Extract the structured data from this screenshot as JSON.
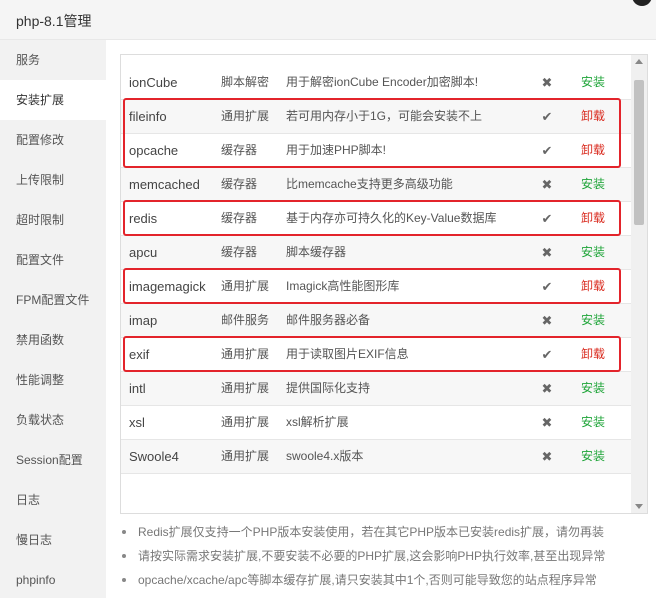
{
  "window": {
    "title": "php-8.1管理"
  },
  "sidebar": {
    "items": [
      {
        "label": "服务"
      },
      {
        "label": "安装扩展"
      },
      {
        "label": "配置修改"
      },
      {
        "label": "上传限制"
      },
      {
        "label": "超时限制"
      },
      {
        "label": "配置文件"
      },
      {
        "label": "FPM配置文件"
      },
      {
        "label": "禁用函数"
      },
      {
        "label": "性能调整"
      },
      {
        "label": "负载状态"
      },
      {
        "label": "Session配置"
      },
      {
        "label": "日志"
      },
      {
        "label": "慢日志"
      },
      {
        "label": "phpinfo"
      }
    ],
    "active_index": 1
  },
  "extensions": [
    {
      "name": "ionCube",
      "type": "脚本解密",
      "desc": "用于解密ionCube Encoder加密脚本!",
      "status": "x",
      "action": "安装"
    },
    {
      "name": "fileinfo",
      "type": "通用扩展",
      "desc": "若可用内存小于1G，可能会安装不上",
      "status": "check",
      "action": "卸载"
    },
    {
      "name": "opcache",
      "type": "缓存器",
      "desc": "用于加速PHP脚本!",
      "status": "check",
      "action": "卸载"
    },
    {
      "name": "memcached",
      "type": "缓存器",
      "desc": "比memcache支持更多高级功能",
      "status": "x",
      "action": "安装"
    },
    {
      "name": "redis",
      "type": "缓存器",
      "desc": "基于内存亦可持久化的Key-Value数据库",
      "status": "check",
      "action": "卸载"
    },
    {
      "name": "apcu",
      "type": "缓存器",
      "desc": "脚本缓存器",
      "status": "x",
      "action": "安装"
    },
    {
      "name": "imagemagick",
      "type": "通用扩展",
      "desc": "Imagick高性能图形库",
      "status": "check",
      "action": "卸载"
    },
    {
      "name": "imap",
      "type": "邮件服务",
      "desc": "邮件服务器必备",
      "status": "x",
      "action": "安装"
    },
    {
      "name": "exif",
      "type": "通用扩展",
      "desc": "用于读取图片EXIF信息",
      "status": "check",
      "action": "卸载"
    },
    {
      "name": "intl",
      "type": "通用扩展",
      "desc": "提供国际化支持",
      "status": "x",
      "action": "安装"
    },
    {
      "name": "xsl",
      "type": "通用扩展",
      "desc": "xsl解析扩展",
      "status": "x",
      "action": "安装"
    },
    {
      "name": "Swoole4",
      "type": "通用扩展",
      "desc": "swoole4.x版本",
      "status": "x",
      "action": "安装"
    }
  ],
  "notes": [
    "Redis扩展仅支持一个PHP版本安装使用，若在其它PHP版本已安装redis扩展，请勿再装",
    "请按实际需求安装扩展,不要安装不必要的PHP扩展,这会影响PHP执行效率,甚至出现异常",
    "opcache/xcache/apc等脚本缓存扩展,请只安装其中1个,否则可能导致您的站点程序异常"
  ],
  "colors": {
    "install": "#20a53a",
    "uninstall": "#d9281c",
    "highlight": "#e3242b"
  },
  "icons": {
    "check": "check-icon",
    "x": "x-icon"
  }
}
